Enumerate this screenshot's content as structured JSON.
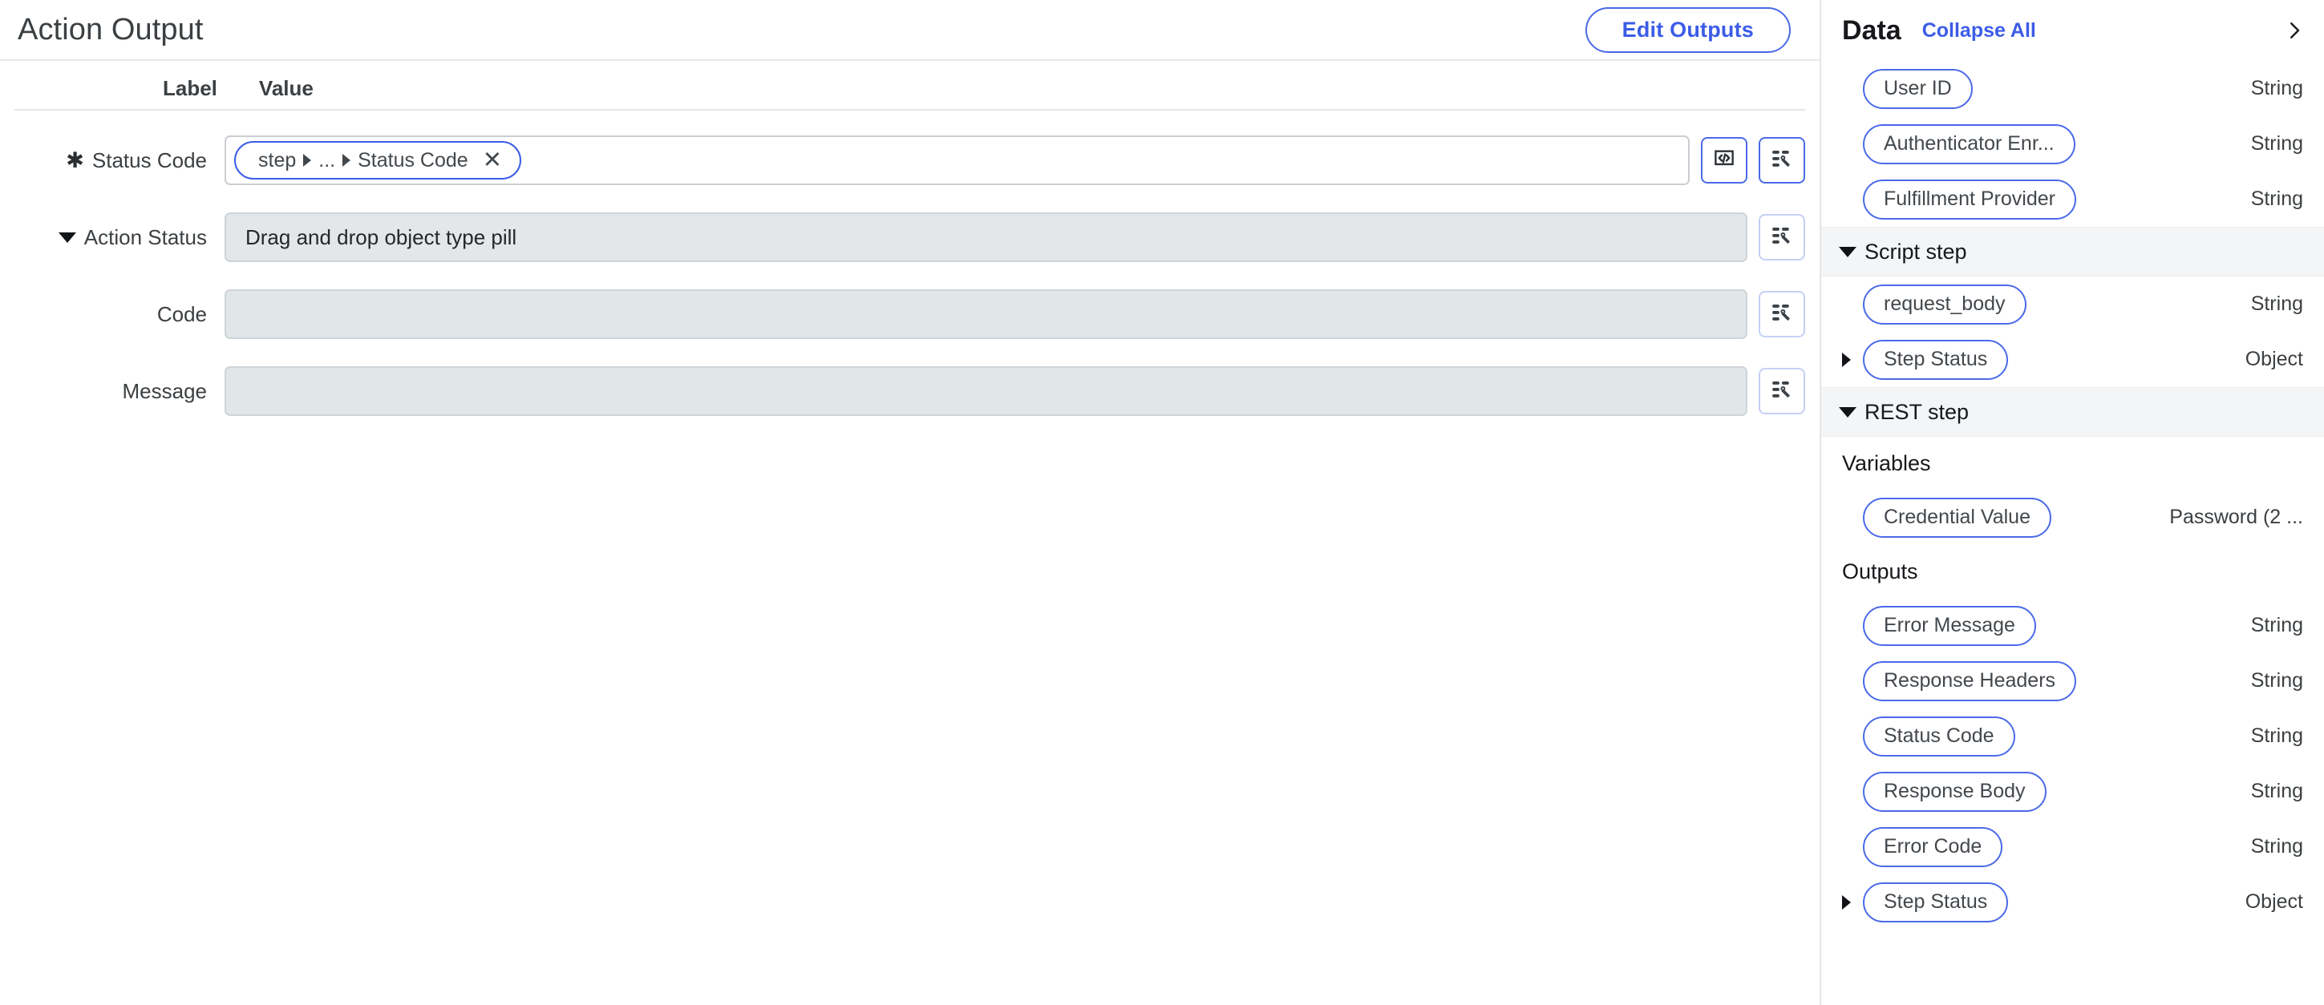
{
  "main": {
    "title": "Action Output",
    "edit_outputs_label": "Edit Outputs",
    "columns": {
      "label": "Label",
      "value": "Value"
    },
    "rows": [
      {
        "label": "Status Code",
        "required_marker": "✱",
        "has_toggle": false,
        "field_kind": "pill",
        "pill": {
          "prefix": "step",
          "middle": "...",
          "suffix": "Status Code",
          "close": "✕"
        },
        "buttons": [
          "code-icon",
          "data-mapper-icon"
        ]
      },
      {
        "label": "Action Status",
        "required_marker": "",
        "has_toggle": true,
        "field_kind": "readonly-text",
        "value": "Drag and drop object type pill",
        "buttons": [
          "data-mapper-icon"
        ]
      },
      {
        "label": "Code",
        "required_marker": "",
        "has_toggle": false,
        "field_kind": "readonly-text",
        "value": "",
        "buttons": [
          "data-mapper-icon"
        ]
      },
      {
        "label": "Message",
        "required_marker": "",
        "has_toggle": false,
        "field_kind": "readonly-text",
        "value": "",
        "buttons": [
          "data-mapper-icon"
        ]
      }
    ]
  },
  "sidebar": {
    "title": "Data",
    "collapse_all_label": "Collapse All",
    "expand_icon": "chevron-right-icon",
    "blocks": [
      {
        "kind": "rows",
        "items": [
          {
            "name": "User ID",
            "type": "String",
            "expandable": false
          },
          {
            "name": "Authenticator Enr...",
            "type": "String",
            "expandable": false
          },
          {
            "name": "Fulfillment Provider",
            "type": "String",
            "expandable": false
          }
        ]
      },
      {
        "kind": "section",
        "title": "Script step",
        "items": [
          {
            "name": "request_body",
            "type": "String",
            "expandable": false
          },
          {
            "name": "Step Status",
            "type": "Object",
            "expandable": true
          }
        ]
      },
      {
        "kind": "section",
        "title": "REST step",
        "groups": [
          {
            "label": "Variables",
            "items": [
              {
                "name": "Credential Value",
                "type": "Password (2 ...",
                "expandable": false
              }
            ]
          },
          {
            "label": "Outputs",
            "items": [
              {
                "name": "Error Message",
                "type": "String",
                "expandable": false
              },
              {
                "name": "Response Headers",
                "type": "String",
                "expandable": false
              },
              {
                "name": "Status Code",
                "type": "String",
                "expandable": false
              },
              {
                "name": "Response Body",
                "type": "String",
                "expandable": false
              },
              {
                "name": "Error Code",
                "type": "String",
                "expandable": false
              },
              {
                "name": "Step Status",
                "type": "Object",
                "expandable": true
              }
            ]
          }
        ]
      }
    ]
  },
  "colors": {
    "accent": "#3c5ce6",
    "pill_border": "#4a6ae8",
    "text": "#3c4043",
    "readonly_bg": "#e3e7e9",
    "section_bg": "#f4f5f6"
  }
}
